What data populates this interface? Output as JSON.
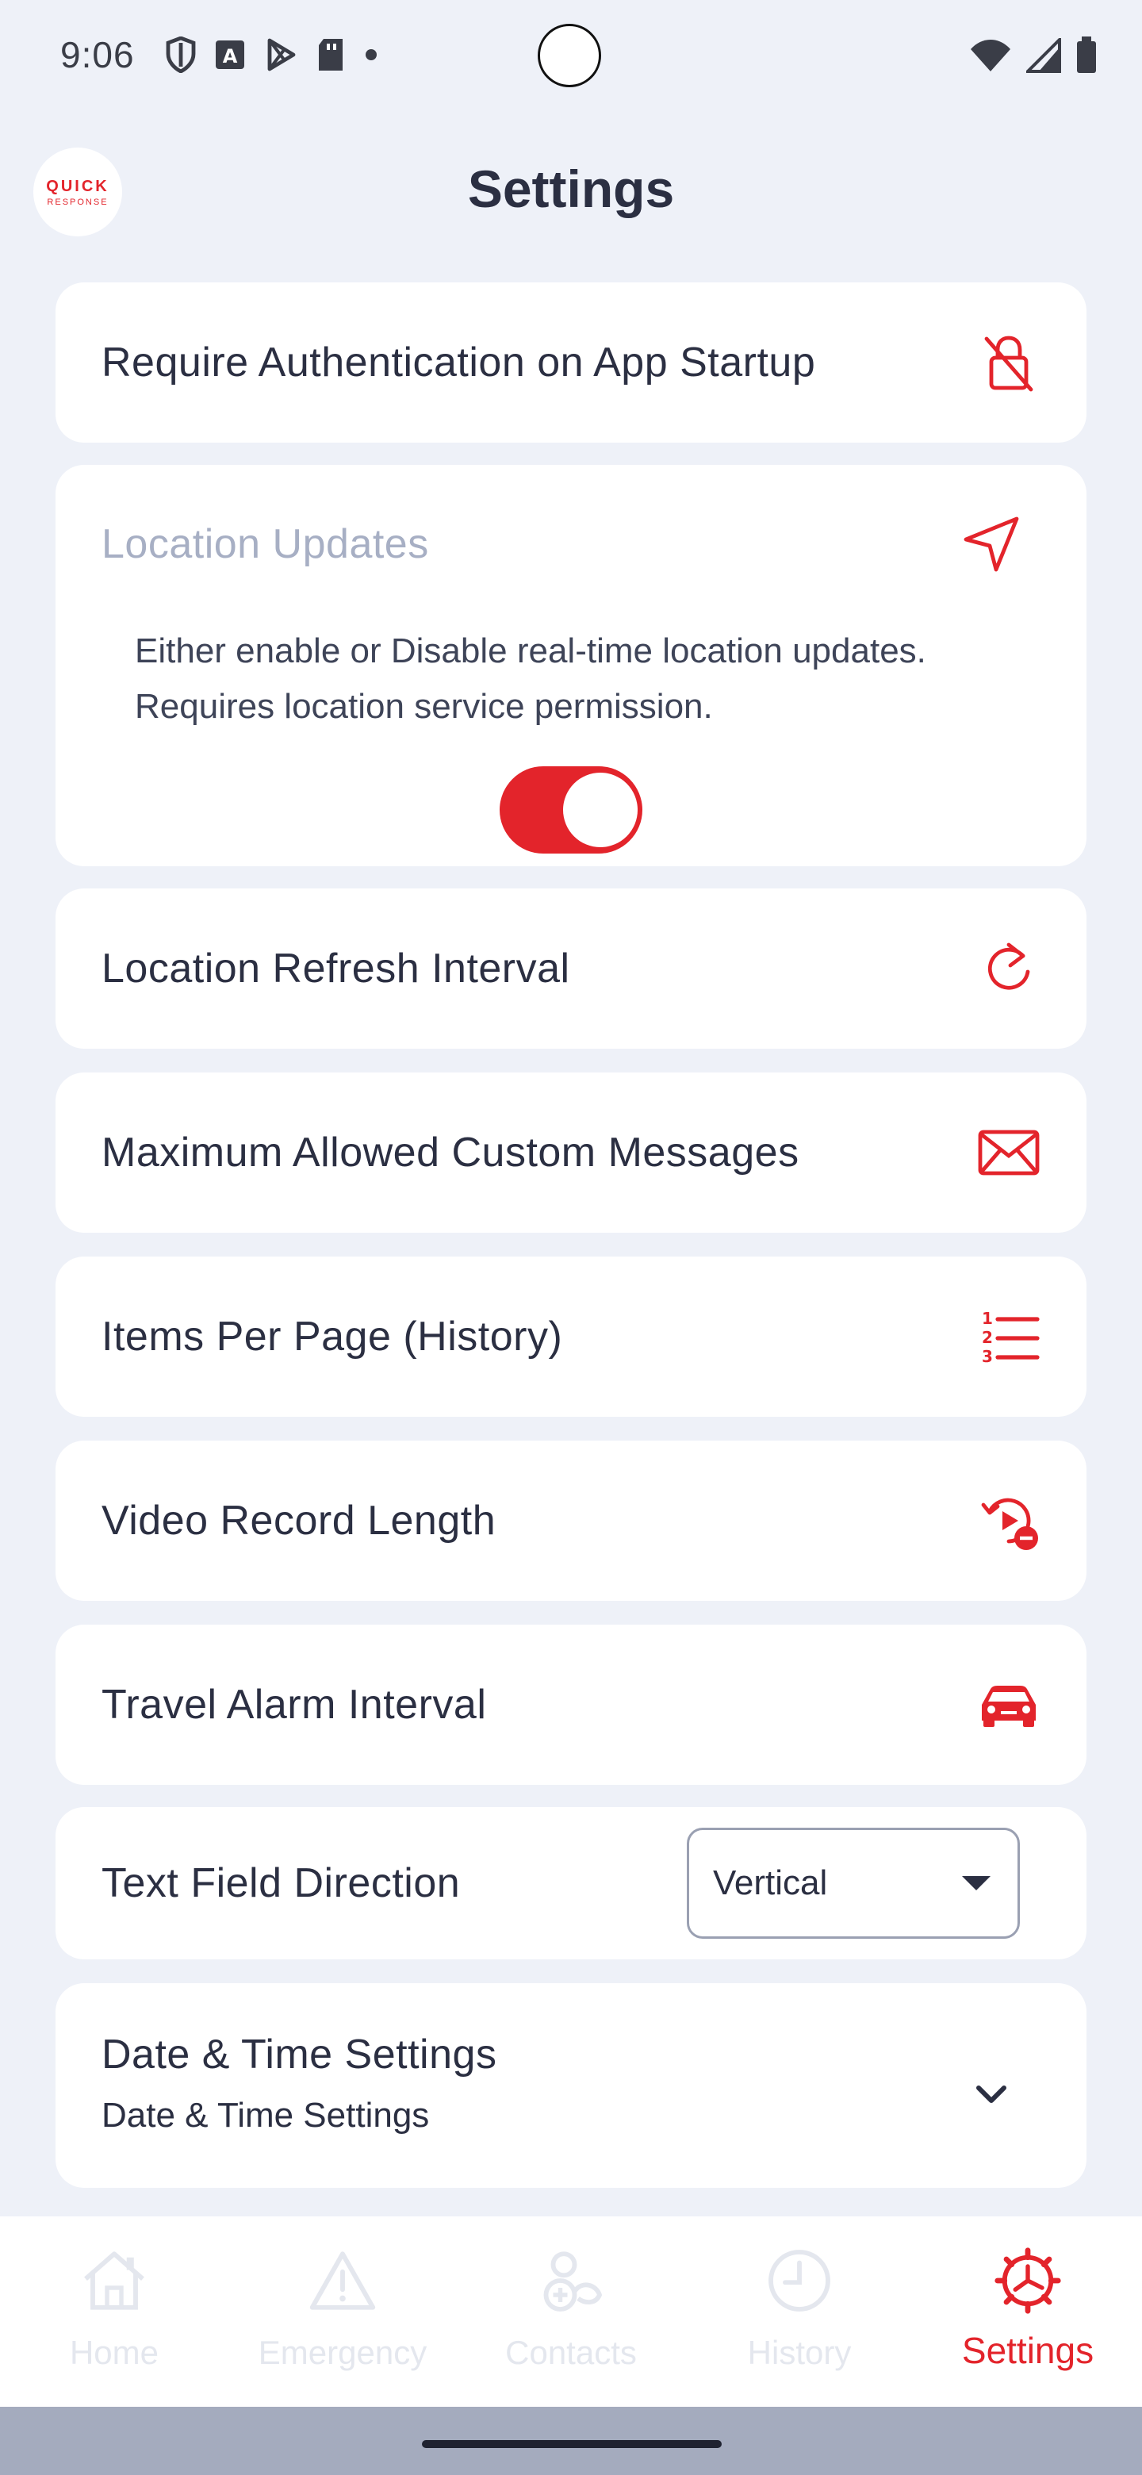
{
  "status_bar": {
    "time": "9:06",
    "left_icons": [
      "shield-icon",
      "text-a-icon",
      "play-store-icon",
      "sd-card-icon",
      "dot-icon"
    ],
    "right_icons": [
      "wifi-icon",
      "signal-icon",
      "battery-icon"
    ]
  },
  "header": {
    "logo_line1": "QUICK",
    "logo_line2": "RESPONSE",
    "title": "Settings"
  },
  "settings": {
    "auth": {
      "label": "Require Authentication on App Startup",
      "icon": "lock-off-icon"
    },
    "location_updates": {
      "title": "Location Updates",
      "icon": "navigation-arrow-icon",
      "description": "Either enable or Disable real-time location updates. Requires location service permission.",
      "enabled": true
    },
    "refresh": {
      "label": "Location Refresh Interval",
      "icon": "refresh-icon"
    },
    "messages": {
      "label": "Maximum Allowed Custom Messages",
      "icon": "envelope-icon"
    },
    "items_per_page": {
      "label": "Items Per Page (History)",
      "icon": "numbered-list-icon"
    },
    "video_length": {
      "label": "Video Record Length",
      "icon": "video-replay-icon"
    },
    "travel_alarm": {
      "label": "Travel Alarm Interval",
      "icon": "car-icon"
    },
    "text_direction": {
      "label": "Text Field Direction",
      "selected": "Vertical"
    },
    "date_time": {
      "title": "Date & Time Settings",
      "subtitle": "Date & Time Settings",
      "icon": "chevron-down-icon"
    }
  },
  "bottom_nav": {
    "items": [
      {
        "label": "Home",
        "icon": "home-icon",
        "active": false
      },
      {
        "label": "Emergency",
        "icon": "warning-icon",
        "active": false
      },
      {
        "label": "Contacts",
        "icon": "contacts-icon",
        "active": false
      },
      {
        "label": "History",
        "icon": "clock-icon",
        "active": false
      },
      {
        "label": "Settings",
        "icon": "gear-icon",
        "active": true
      }
    ]
  },
  "colors": {
    "accent": "#E3242B",
    "background": "#EEF1F8",
    "card": "#FFFFFF",
    "text": "#2B2F42",
    "muted": "#A7AFC4",
    "inactive_nav": "#E4E7EE"
  }
}
